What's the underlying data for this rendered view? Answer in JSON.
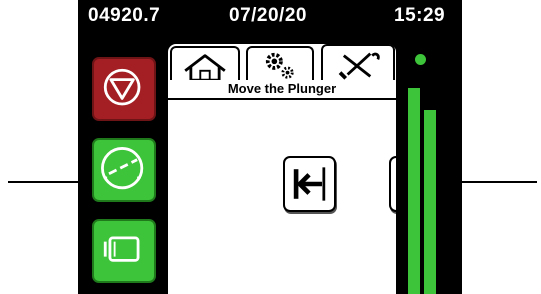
{
  "status_bar": {
    "counter": "04920.7",
    "date": "07/20/20",
    "time": "15:29"
  },
  "side_buttons": [
    {
      "name": "stop",
      "icon": "stop-icon",
      "color": "#a31f24"
    },
    {
      "name": "gauge",
      "icon": "gauge-icon",
      "color": "#3ec43a"
    },
    {
      "name": "motor",
      "icon": "motor-icon",
      "color": "#3ec43a"
    }
  ],
  "tabs": [
    {
      "icon": "home-icon",
      "active": false
    },
    {
      "icon": "gears-icon",
      "active": false
    },
    {
      "icon": "tools-icon",
      "active": true
    }
  ],
  "screen": {
    "title": "Move the Plunger"
  },
  "jog_buttons": [
    {
      "icon": "jog-left-icon"
    },
    {
      "icon": "jog-right-icon"
    }
  ],
  "meter": {
    "indicator_color": "#3ec43a"
  },
  "callout_arrows": [
    "arrow-right-icon",
    "arrow-left-icon"
  ]
}
